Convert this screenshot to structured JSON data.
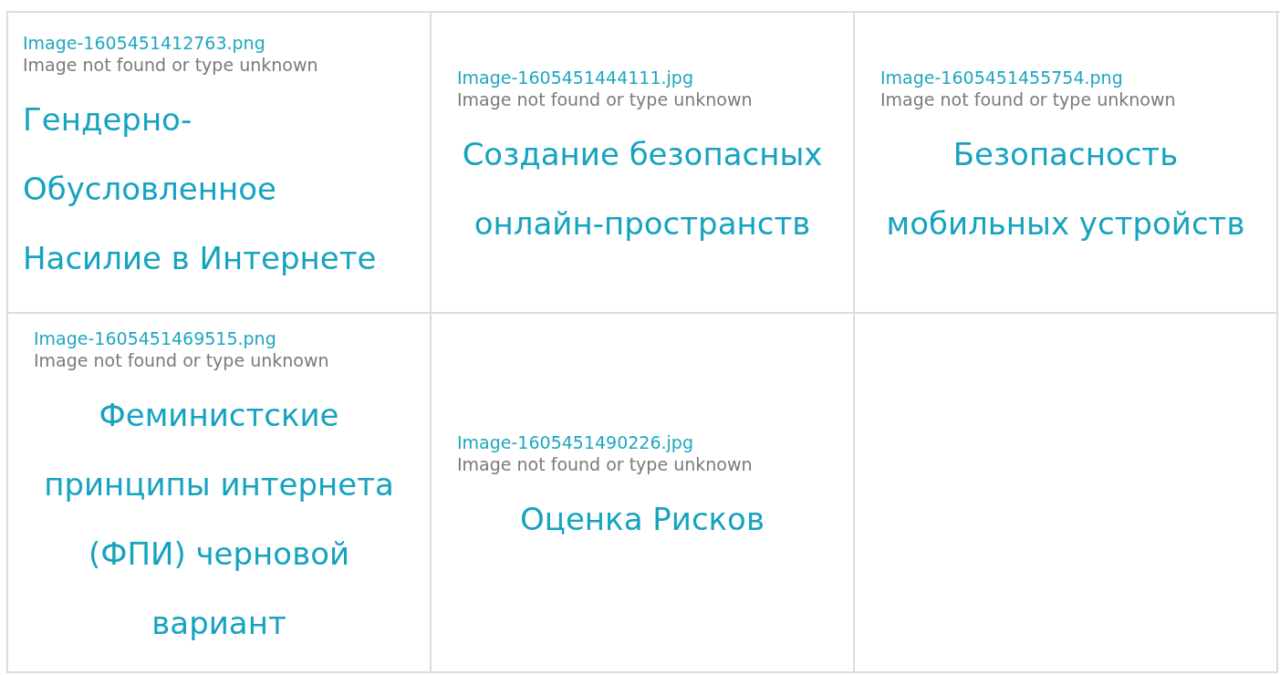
{
  "cards": [
    {
      "image_alt": "Image-1605451412763.png",
      "image_error": "Image not found or type unknown",
      "title": "Гендерно-Обусловленное Насилие в Интернете"
    },
    {
      "image_alt": "Image-1605451444111.jpg",
      "image_error": "Image not found or type unknown",
      "title": "Создание безопасных онлайн-пространств"
    },
    {
      "image_alt": "Image-1605451455754.png",
      "image_error": "Image not found or type unknown",
      "title": "Безопасность мобильных устройств"
    },
    {
      "image_alt": "Image-1605451469515.png",
      "image_error": "Image not found or type unknown",
      "title": "Феминистские принципы интернета (ФПИ) черновой вариант"
    },
    {
      "image_alt": "Image-1605451490226.jpg",
      "image_error": "Image not found or type unknown",
      "title": "Оценка Рисков"
    }
  ]
}
